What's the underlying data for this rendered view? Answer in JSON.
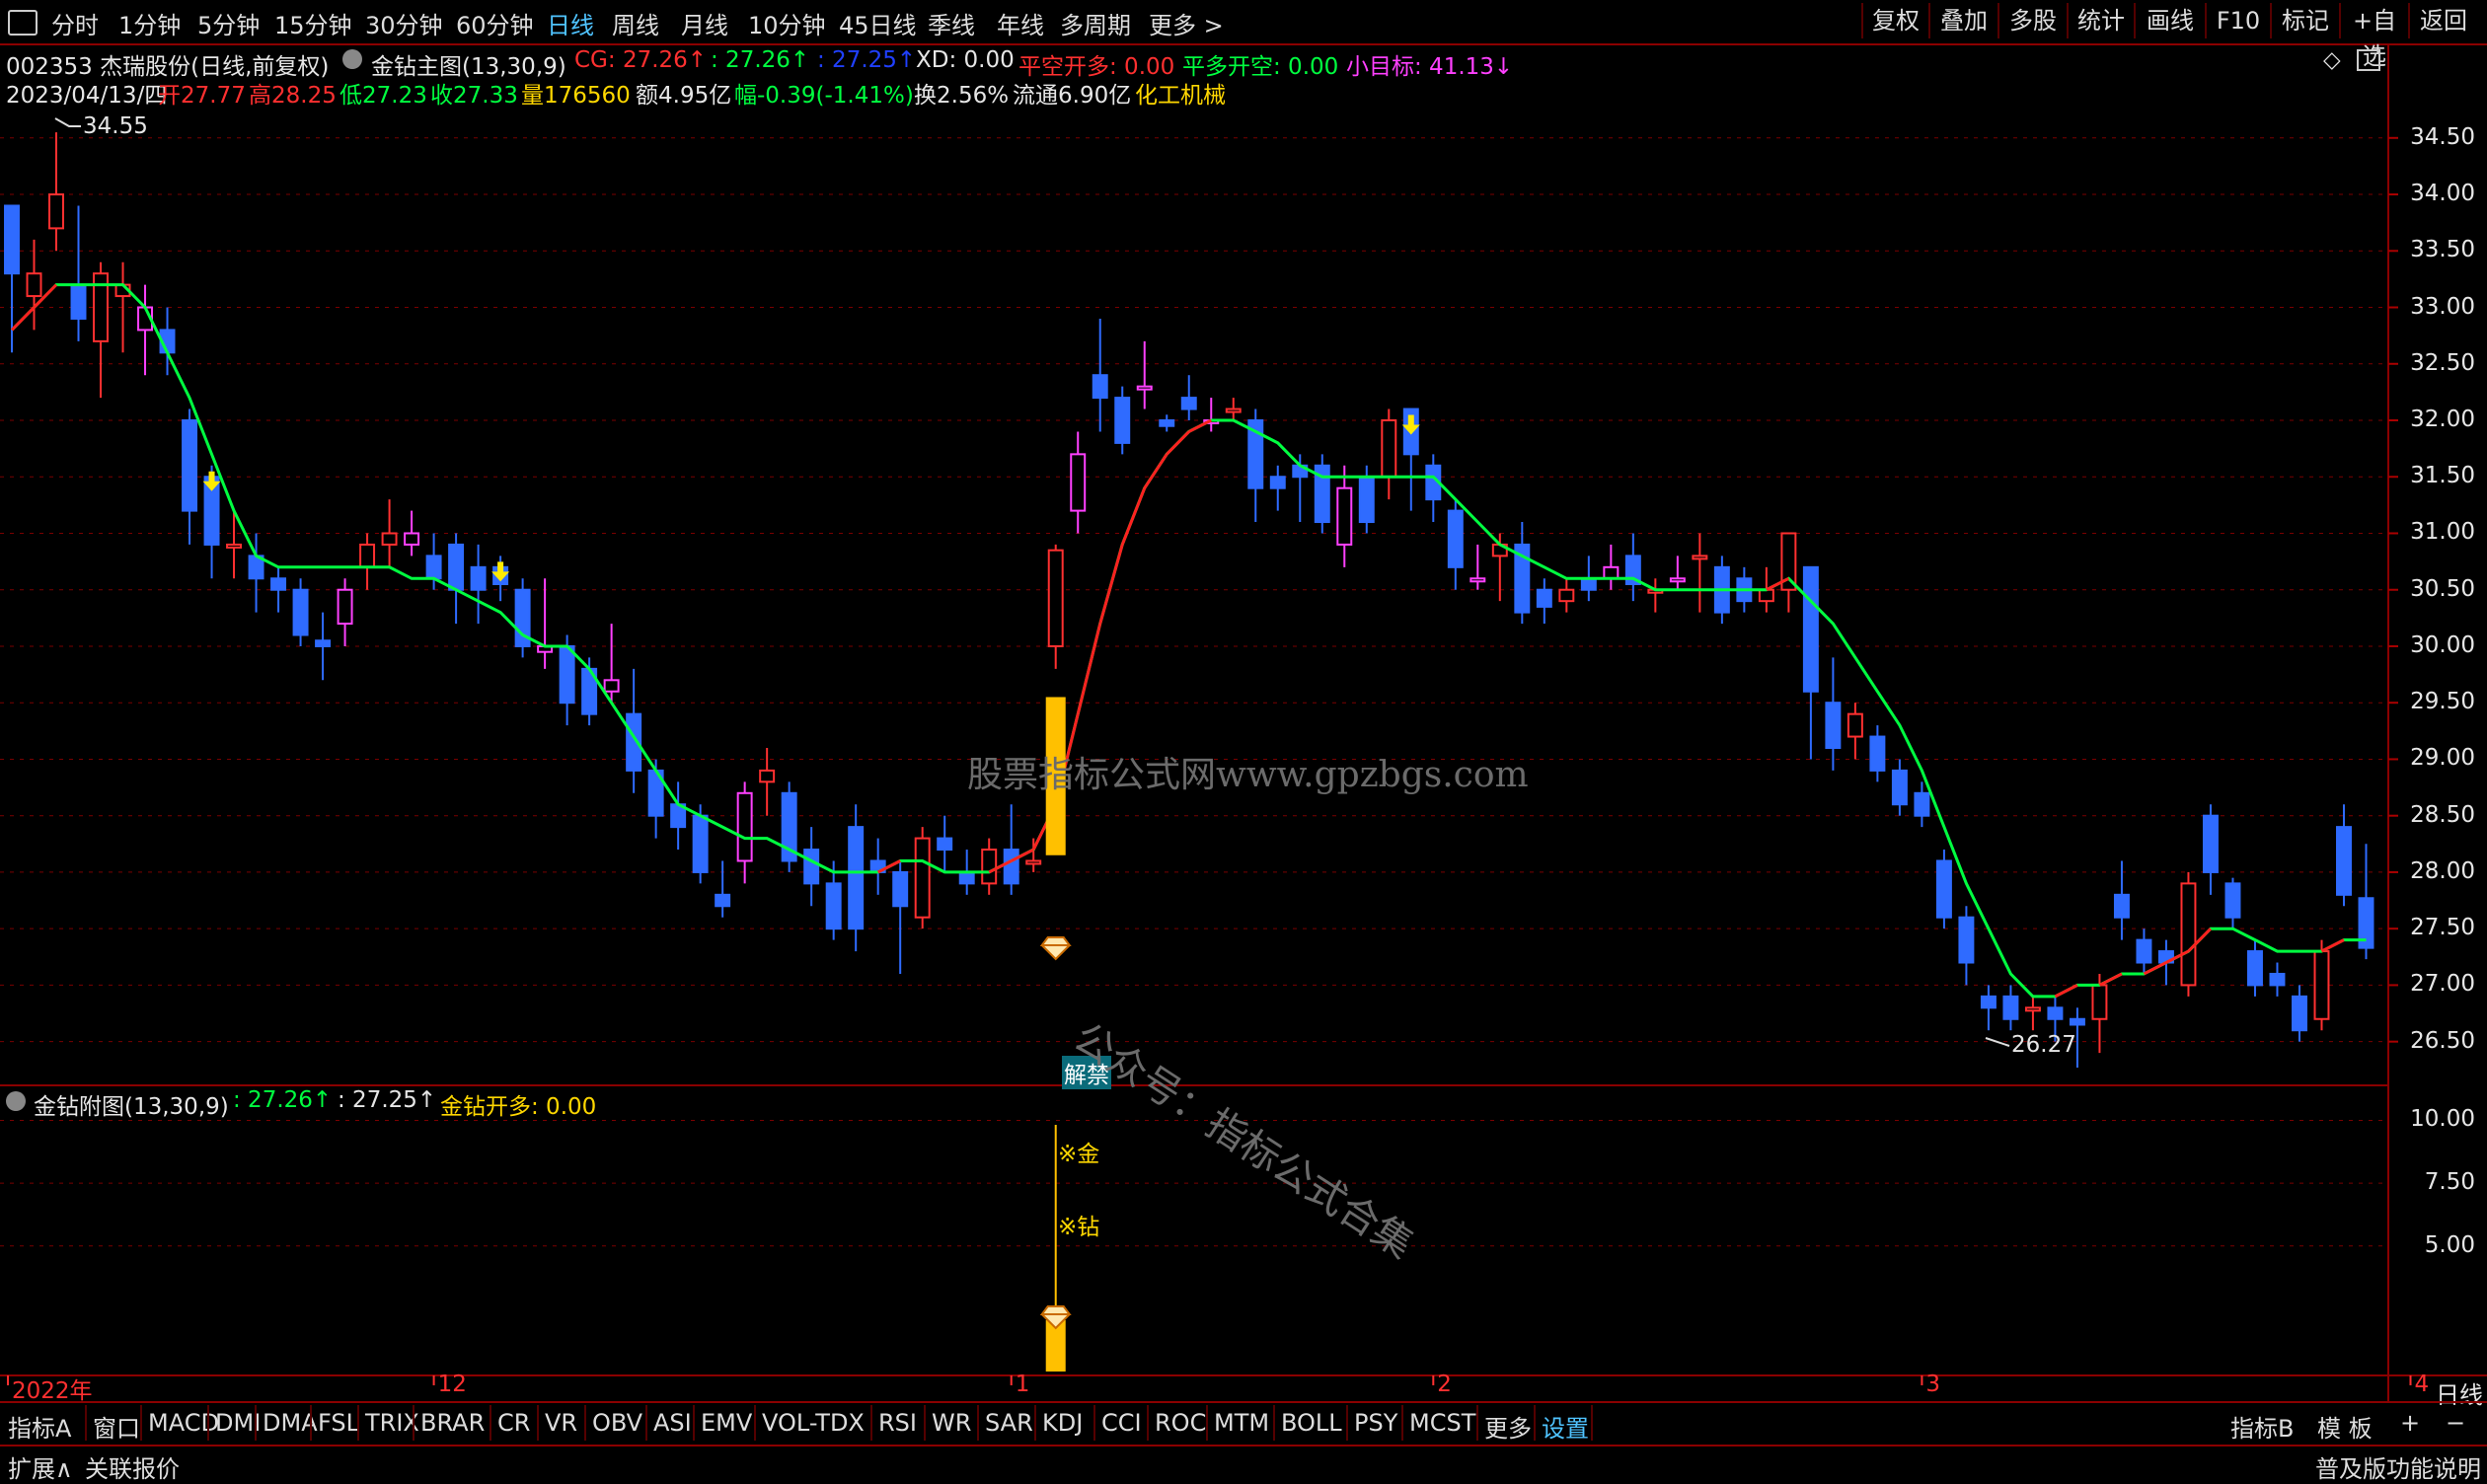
{
  "toolbar": {
    "periods": [
      "分时",
      "1分钟",
      "5分钟",
      "15分钟",
      "30分钟",
      "60分钟",
      "日线",
      "周线",
      "月线",
      "10分钟",
      "45日线",
      "季线",
      "年线",
      "多周期",
      "更多 >"
    ],
    "active_period": "日线",
    "right_buttons": [
      "复权",
      "叠加",
      "多股",
      "统计",
      "画线",
      "F10",
      "标记",
      "+自选",
      "返回"
    ]
  },
  "info_line1": {
    "stock": "002353 杰瑞股份(日线,前复权)",
    "indicator": "金钻主图(13,30,9)",
    "cg_label": "CG: 27.26↑",
    "v2": ": 27.26↑",
    "v3": ": 27.25↑",
    "xd": "XD: 0.00",
    "pk": "平空开多: 0.00",
    "pd": "平多开空: 0.00",
    "target": "小目标: 41.13↓"
  },
  "info_line2": {
    "date": "2023/04/13/四",
    "open": "开27.77",
    "high": "高28.25",
    "low": "低27.23",
    "close": "收27.33",
    "vol": "量176560",
    "amount": "额4.95亿",
    "change": "幅-0.39(-1.41%)",
    "turnover": "换2.56%",
    "float": "流通6.90亿",
    "sector": "化工机械"
  },
  "sub_panel": {
    "title": "金钻附图(13,30,9)",
    "v1": ": 27.26↑",
    "v2": ": 27.25↑",
    "signal": "金钻开多: 0.00",
    "mark1": "※金",
    "mark2": "※钻"
  },
  "annotations": {
    "high_label": "34.55",
    "low_label": "26.27",
    "unlock_tag": "解禁",
    "watermark1": "股票指标公式网www.gpzbgs.com",
    "watermark2": "公众号：指标公式合集"
  },
  "axis": {
    "main_ticks": [
      "34.50",
      "34.00",
      "33.50",
      "33.00",
      "32.50",
      "32.00",
      "31.50",
      "31.00",
      "30.50",
      "30.00",
      "29.50",
      "29.00",
      "28.50",
      "28.00",
      "27.50",
      "27.00",
      "26.50"
    ],
    "sub_ticks": [
      "10.00",
      "7.50",
      "5.00"
    ],
    "x_labels": [
      "2022年",
      "12",
      "1",
      "2",
      "3",
      "4"
    ],
    "period_label": "日线"
  },
  "tabs": [
    "指标A",
    "窗口",
    "MACD",
    "DMI",
    "DMA",
    "FSL",
    "TRIX",
    "BRAR",
    "CR",
    "VR",
    "OBV",
    "ASI",
    "EMV",
    "VOL-TDX",
    "RSI",
    "WR",
    "SAR",
    "KDJ",
    "CCI",
    "ROC",
    "MTM",
    "BOLL",
    "PSY",
    "MCST",
    "更多",
    "设置"
  ],
  "tabs_right": [
    "指标B",
    "模 板",
    "+",
    "−"
  ],
  "statusbar": {
    "left1": "扩展∧",
    "left2": "关联报价",
    "right": "普及版功能说明"
  },
  "colors": {
    "up": "#ff3030",
    "down": "#2f6bff",
    "up_alt": "#ff40ff",
    "ma_down": "#00ff40",
    "ma_up": "#ff2020",
    "gold": "#ffc000"
  },
  "chart_data": {
    "type": "candlestick",
    "ylim": [
      26.2,
      34.9
    ],
    "candles": [
      [
        33.9,
        33.3,
        33.9,
        32.6
      ],
      [
        33.1,
        33.3,
        33.6,
        32.8
      ],
      [
        33.7,
        34.0,
        34.55,
        33.5
      ],
      [
        33.2,
        32.9,
        33.9,
        32.7
      ],
      [
        32.7,
        33.3,
        33.4,
        32.2
      ],
      [
        33.1,
        33.2,
        33.4,
        32.6
      ],
      [
        32.8,
        33.0,
        33.2,
        32.4
      ],
      [
        32.8,
        32.6,
        33.0,
        32.4
      ],
      [
        32.0,
        31.2,
        32.1,
        30.9
      ],
      [
        31.5,
        30.9,
        31.6,
        30.6
      ],
      [
        30.9,
        30.9,
        31.2,
        30.6
      ],
      [
        30.8,
        30.6,
        31.0,
        30.3
      ],
      [
        30.6,
        30.5,
        30.7,
        30.3
      ],
      [
        30.5,
        30.1,
        30.6,
        30.0
      ],
      [
        30.05,
        30.0,
        30.3,
        29.7
      ],
      [
        30.2,
        30.5,
        30.6,
        30.0
      ],
      [
        30.7,
        30.9,
        31.0,
        30.5
      ],
      [
        30.9,
        31.0,
        31.3,
        30.7
      ],
      [
        30.9,
        31.0,
        31.2,
        30.8
      ],
      [
        30.8,
        30.6,
        31.0,
        30.5
      ],
      [
        30.9,
        30.5,
        31.0,
        30.2
      ],
      [
        30.7,
        30.5,
        30.9,
        30.2
      ],
      [
        30.7,
        30.55,
        30.8,
        30.4
      ],
      [
        30.5,
        30.0,
        30.6,
        29.9
      ],
      [
        29.95,
        30.0,
        30.6,
        29.8
      ],
      [
        30.0,
        29.5,
        30.1,
        29.3
      ],
      [
        29.8,
        29.4,
        29.9,
        29.3
      ],
      [
        29.6,
        29.7,
        30.2,
        29.5
      ],
      [
        29.4,
        28.9,
        29.8,
        28.7
      ],
      [
        28.9,
        28.5,
        29.0,
        28.3
      ],
      [
        28.6,
        28.4,
        28.8,
        28.2
      ],
      [
        28.5,
        28.0,
        28.6,
        27.9
      ],
      [
        27.8,
        27.7,
        28.1,
        27.6
      ],
      [
        28.1,
        28.7,
        28.8,
        27.9
      ],
      [
        28.8,
        28.9,
        29.1,
        28.5
      ],
      [
        28.7,
        28.1,
        28.8,
        28.0
      ],
      [
        28.2,
        27.9,
        28.4,
        27.7
      ],
      [
        27.9,
        27.5,
        28.1,
        27.4
      ],
      [
        28.4,
        27.5,
        28.6,
        27.3
      ],
      [
        28.1,
        28.0,
        28.3,
        27.8
      ],
      [
        28.0,
        27.7,
        28.1,
        27.1
      ],
      [
        27.6,
        28.3,
        28.4,
        27.5
      ],
      [
        28.3,
        28.2,
        28.5,
        28.0
      ],
      [
        28.0,
        27.9,
        28.2,
        27.8
      ],
      [
        27.9,
        28.2,
        28.3,
        27.8
      ],
      [
        28.2,
        27.9,
        28.6,
        27.8
      ],
      [
        28.1,
        28.1,
        28.3,
        28.0
      ],
      [
        30.0,
        30.85,
        30.9,
        29.8
      ],
      [
        31.2,
        31.7,
        31.9,
        31.0
      ],
      [
        32.4,
        32.2,
        32.9,
        31.9
      ],
      [
        32.2,
        31.8,
        32.3,
        31.7
      ],
      [
        32.3,
        32.3,
        32.7,
        32.1
      ],
      [
        32.0,
        31.95,
        32.05,
        31.9
      ],
      [
        32.2,
        32.1,
        32.4,
        32.0
      ],
      [
        32.0,
        32.0,
        32.2,
        31.9
      ],
      [
        32.1,
        32.1,
        32.2,
        32.0
      ],
      [
        32.0,
        31.4,
        32.1,
        31.1
      ],
      [
        31.5,
        31.4,
        31.6,
        31.2
      ],
      [
        31.6,
        31.5,
        31.7,
        31.1
      ],
      [
        31.6,
        31.1,
        31.7,
        31.0
      ],
      [
        30.9,
        31.4,
        31.6,
        30.7
      ],
      [
        31.5,
        31.1,
        31.6,
        31.0
      ],
      [
        31.5,
        32.0,
        32.1,
        31.3
      ],
      [
        32.1,
        31.7,
        32.1,
        31.2
      ],
      [
        31.6,
        31.3,
        31.7,
        31.1
      ],
      [
        31.2,
        30.7,
        31.3,
        30.5
      ],
      [
        30.6,
        30.6,
        30.9,
        30.5
      ],
      [
        30.8,
        30.9,
        31.0,
        30.4
      ],
      [
        30.9,
        30.3,
        31.1,
        30.2
      ],
      [
        30.5,
        30.35,
        30.6,
        30.2
      ],
      [
        30.4,
        30.5,
        30.6,
        30.3
      ],
      [
        30.6,
        30.5,
        30.8,
        30.4
      ],
      [
        30.6,
        30.7,
        30.9,
        30.5
      ],
      [
        30.8,
        30.55,
        31.0,
        30.4
      ],
      [
        30.5,
        30.5,
        30.6,
        30.3
      ],
      [
        30.6,
        30.6,
        30.8,
        30.5
      ],
      [
        30.8,
        30.8,
        31.0,
        30.3
      ],
      [
        30.7,
        30.3,
        30.8,
        30.2
      ],
      [
        30.6,
        30.4,
        30.7,
        30.3
      ],
      [
        30.4,
        30.5,
        30.7,
        30.3
      ],
      [
        30.5,
        31.0,
        31.0,
        30.3
      ],
      [
        30.7,
        29.6,
        30.7,
        29.0
      ],
      [
        29.5,
        29.1,
        29.9,
        28.9
      ],
      [
        29.2,
        29.4,
        29.5,
        29.0
      ],
      [
        29.2,
        28.9,
        29.3,
        28.8
      ],
      [
        28.9,
        28.6,
        29.0,
        28.5
      ],
      [
        28.7,
        28.5,
        28.8,
        28.4
      ],
      [
        28.1,
        27.6,
        28.2,
        27.5
      ],
      [
        27.6,
        27.2,
        27.7,
        27.0
      ],
      [
        26.9,
        26.8,
        27.0,
        26.6
      ],
      [
        26.9,
        26.7,
        27.0,
        26.6
      ],
      [
        26.8,
        26.8,
        26.9,
        26.6
      ],
      [
        26.8,
        26.7,
        26.9,
        26.5
      ],
      [
        26.7,
        26.65,
        26.8,
        26.27
      ],
      [
        26.7,
        27.0,
        27.1,
        26.4
      ],
      [
        27.8,
        27.6,
        28.1,
        27.4
      ],
      [
        27.4,
        27.2,
        27.5,
        27.1
      ],
      [
        27.3,
        27.2,
        27.4,
        27.0
      ],
      [
        27.0,
        27.9,
        28.0,
        26.9
      ],
      [
        28.5,
        28.0,
        28.6,
        27.8
      ],
      [
        27.9,
        27.6,
        27.95,
        27.5
      ],
      [
        27.3,
        27.0,
        27.4,
        26.9
      ],
      [
        27.1,
        27.0,
        27.2,
        26.9
      ],
      [
        26.9,
        26.6,
        27.0,
        26.5
      ],
      [
        26.7,
        27.3,
        27.4,
        26.6
      ],
      [
        28.4,
        27.8,
        28.6,
        27.7
      ],
      [
        27.77,
        27.33,
        28.25,
        27.23
      ]
    ],
    "ma": [
      32.8,
      33.0,
      33.2,
      33.2,
      33.2,
      33.2,
      33.0,
      32.6,
      32.2,
      31.7,
      31.2,
      30.8,
      30.7,
      30.7,
      30.7,
      30.7,
      30.7,
      30.7,
      30.6,
      30.6,
      30.5,
      30.4,
      30.3,
      30.1,
      30.0,
      30.0,
      29.8,
      29.5,
      29.2,
      28.9,
      28.6,
      28.5,
      28.4,
      28.3,
      28.3,
      28.2,
      28.1,
      28.0,
      28.0,
      28.0,
      28.1,
      28.1,
      28.0,
      28.0,
      28.0,
      28.1,
      28.2,
      28.6,
      29.4,
      30.2,
      30.9,
      31.4,
      31.7,
      31.9,
      32.0,
      32.0,
      31.9,
      31.8,
      31.6,
      31.5,
      31.5,
      31.5,
      31.5,
      31.5,
      31.5,
      31.3,
      31.1,
      30.9,
      30.8,
      30.7,
      30.6,
      30.6,
      30.6,
      30.6,
      30.5,
      30.5,
      30.5,
      30.5,
      30.5,
      30.5,
      30.6,
      30.4,
      30.2,
      29.9,
      29.6,
      29.3,
      28.9,
      28.4,
      27.9,
      27.5,
      27.1,
      26.9,
      26.9,
      27.0,
      27.0,
      27.1,
      27.1,
      27.2,
      27.3,
      27.5,
      27.5,
      27.4,
      27.3,
      27.3,
      27.3,
      27.4,
      27.4
    ],
    "arrows_down": [
      9,
      22,
      63
    ],
    "gold_signal_index": 47
  }
}
